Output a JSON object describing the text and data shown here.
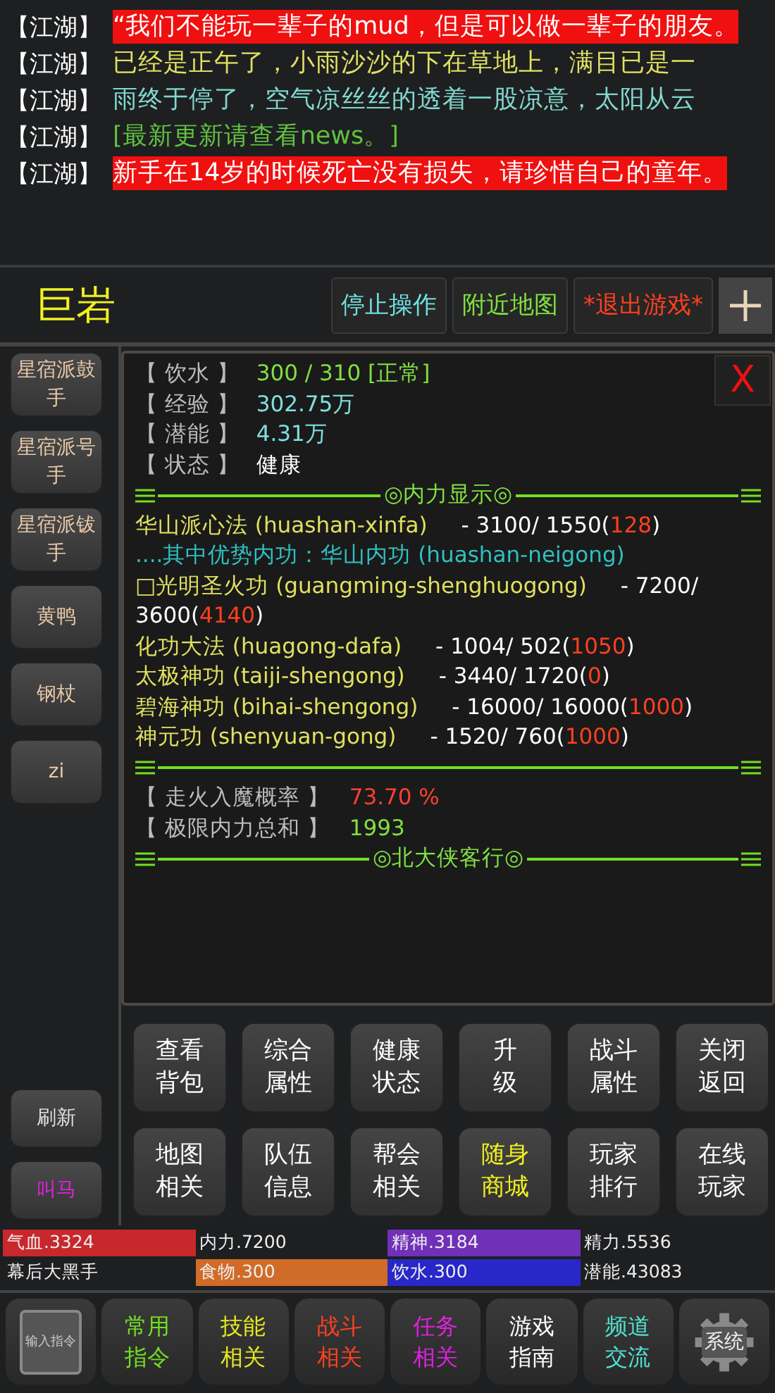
{
  "chat": [
    {
      "channel": "【江湖】",
      "text": "“我们不能玩一辈子的mud，但是可以做一辈子的朋友。",
      "color": "#ffffff",
      "highlight": true
    },
    {
      "channel": "【江湖】",
      "text": "已经是正午了，小雨沙沙的下在草地上，满目已是一",
      "color": "#e0e060",
      "highlight": false
    },
    {
      "channel": "【江湖】",
      "text": "雨终于停了，空气凉丝丝的透着一股凉意，太阳从云",
      "color": "#80d8d0",
      "highlight": false
    },
    {
      "channel": "【江湖】",
      "text": "[最新更新请查看news。]",
      "color": "#60c040",
      "highlight": false
    },
    {
      "channel": "【江湖】",
      "text": "新手在14岁的时候死亡没有损失，请珍惜自己的童年。",
      "color": "#ffffff",
      "highlight": true
    }
  ],
  "header": {
    "name": "巨岩",
    "actions": [
      {
        "label": "停止操作",
        "color": "#70e0e0"
      },
      {
        "label": "附近地图",
        "color": "#80e040"
      },
      {
        "label": "*退出游戏*",
        "color": "#ff4020"
      }
    ]
  },
  "side_items": [
    {
      "label": "星宿派鼓手"
    },
    {
      "label": "星宿派号手"
    },
    {
      "label": "星宿派钹手"
    },
    {
      "label": "黄鸭"
    },
    {
      "label": "钢杖"
    },
    {
      "label": "zi"
    }
  ],
  "side_bottom": [
    {
      "label": "刷新",
      "color": "#e0e0e0"
    },
    {
      "label": "叫马",
      "color": "#e020e0"
    }
  ],
  "panel": {
    "close": "X",
    "status": [
      {
        "label": "【 饮水 】",
        "value": "300   / 310   [正常]",
        "color": "#80e040"
      },
      {
        "label": "【 经验 】",
        "value": "302.75万",
        "color": "#80e0e0"
      },
      {
        "label": "【 潜能 】",
        "value": "4.31万",
        "color": "#80e0e0"
      },
      {
        "label": "【 状态 】",
        "value": "健康",
        "color": "#ffffff"
      }
    ],
    "divider_1": "◎内力显示◎",
    "skills": [
      {
        "kind": "skill",
        "name": "华山派心法 (huashan-xinfa)",
        "value": "-   3100/ 1550(",
        "limit": "128",
        "end": ")"
      },
      {
        "kind": "note",
        "name": "....其中优势内功：华山内功 (huashan-neigong)"
      },
      {
        "kind": "skill",
        "name": "□光明圣火功 (guangming-shenghuogong)",
        "value": "-   7200/ 3600(",
        "limit": "4140",
        "end": ")"
      },
      {
        "kind": "skill",
        "name": "化功大法 (huagong-dafa)",
        "value": "-   1004/ 502(",
        "limit": "1050",
        "end": ")"
      },
      {
        "kind": "skill",
        "name": "太极神功 (taiji-shengong)",
        "value": "-   3440/  1720(",
        "limit": "0",
        "end": ")"
      },
      {
        "kind": "skill",
        "name": "碧海神功 (bihai-shengong)",
        "value": "-   16000/ 16000(",
        "limit": "1000",
        "end": ")"
      },
      {
        "kind": "skill",
        "name": "神元功 (shenyuan-gong)",
        "value": "-   1520/   760(",
        "limit": "1000",
        "end": ")"
      }
    ],
    "summary": [
      {
        "label": "【 走火入魔概率 】",
        "value": "73.70 %",
        "color": "#ff4030"
      },
      {
        "label": "【 极限内力总和 】",
        "value": "1993",
        "color": "#80e040"
      }
    ],
    "divider_3": "◎北大侠客行◎"
  },
  "menu": [
    {
      "lines": [
        "查看",
        "背包"
      ],
      "color": "#ffffff"
    },
    {
      "lines": [
        "综合",
        "属性"
      ],
      "color": "#ffffff"
    },
    {
      "lines": [
        "健康",
        "状态"
      ],
      "color": "#ffffff"
    },
    {
      "lines": [
        "升",
        "级"
      ],
      "color": "#ffffff"
    },
    {
      "lines": [
        "战斗",
        "属性"
      ],
      "color": "#ffffff"
    },
    {
      "lines": [
        "关闭",
        "返回"
      ],
      "color": "#ffffff"
    },
    {
      "lines": [
        "地图",
        "相关"
      ],
      "color": "#ffffff"
    },
    {
      "lines": [
        "队伍",
        "信息"
      ],
      "color": "#ffffff"
    },
    {
      "lines": [
        "帮会",
        "相关"
      ],
      "color": "#ffffff"
    },
    {
      "lines": [
        "随身",
        "商城"
      ],
      "color": "#f0f020"
    },
    {
      "lines": [
        "玩家",
        "排行"
      ],
      "color": "#ffffff"
    },
    {
      "lines": [
        "在线",
        "玩家"
      ],
      "color": "#ffffff"
    }
  ],
  "stats": [
    {
      "label": "气血.3324",
      "color": "#c8282c"
    },
    {
      "label": "内力.7200"
    },
    {
      "label": "精神.3184",
      "color": "#7030b8"
    },
    {
      "label": "精力.5536"
    },
    {
      "label": "幕后大黑手"
    },
    {
      "label": "食物.300",
      "color": "#d06c28"
    },
    {
      "label": "饮水.300",
      "color": "#2828c8"
    },
    {
      "label": "潜能.43083"
    }
  ],
  "toolbar": {
    "input": "输入指令",
    "buttons": [
      {
        "lines": [
          "常用",
          "指令"
        ],
        "color": "#70e020"
      },
      {
        "lines": [
          "技能",
          "相关"
        ],
        "color": "#e8e820"
      },
      {
        "lines": [
          "战斗",
          "相关"
        ],
        "color": "#ff4020"
      },
      {
        "lines": [
          "任务",
          "相关"
        ],
        "color": "#e020e0"
      },
      {
        "lines": [
          "游戏",
          "指南"
        ],
        "color": "#ffffff"
      },
      {
        "lines": [
          "频道",
          "交流"
        ],
        "color": "#50e0d0"
      }
    ],
    "system": "系统"
  }
}
